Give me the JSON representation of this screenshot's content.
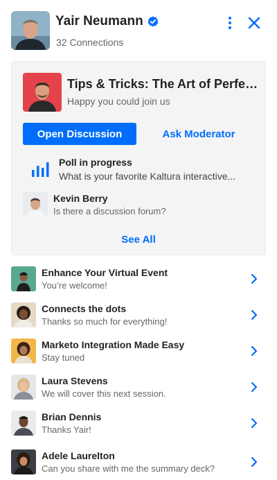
{
  "header": {
    "name": "Yair Neumann",
    "connections": "32 Connections"
  },
  "card": {
    "title": "Tips & Tricks: The Art of Perfect...",
    "subtitle": "Happy you could join us",
    "primary_button": "Open Discussion",
    "secondary_button": "Ask Moderator",
    "poll": {
      "title": "Poll in progress",
      "text": "What is your favorite Kaltura interactive..."
    },
    "message": {
      "name": "Kevin Berry",
      "text": "Is there a discussion forum?"
    },
    "see_all": "See All"
  },
  "list": [
    {
      "title": "Enhance Your Virtual Event",
      "text": "You’re welcome!"
    },
    {
      "title": "Connects the dots",
      "text": "Thanks so much for everything!"
    },
    {
      "title": "Marketo Integration Made Easy",
      "text": "Stay tuned"
    },
    {
      "title": "Laura Stevens",
      "text": "We will cover this next session."
    },
    {
      "title": "Brian Dennis",
      "text": "Thanks Yair!"
    },
    {
      "title": "Adele Laurelton",
      "text": "Can you share with me the summary deck?"
    }
  ],
  "colors": {
    "accent": "#006efa",
    "card_background": "#f4f4f4"
  },
  "icons": {
    "verified": "verified-check-icon",
    "menu": "kebab-menu-icon",
    "close": "close-icon",
    "poll": "bar-chart-icon",
    "chevron": "chevron-right-icon"
  }
}
